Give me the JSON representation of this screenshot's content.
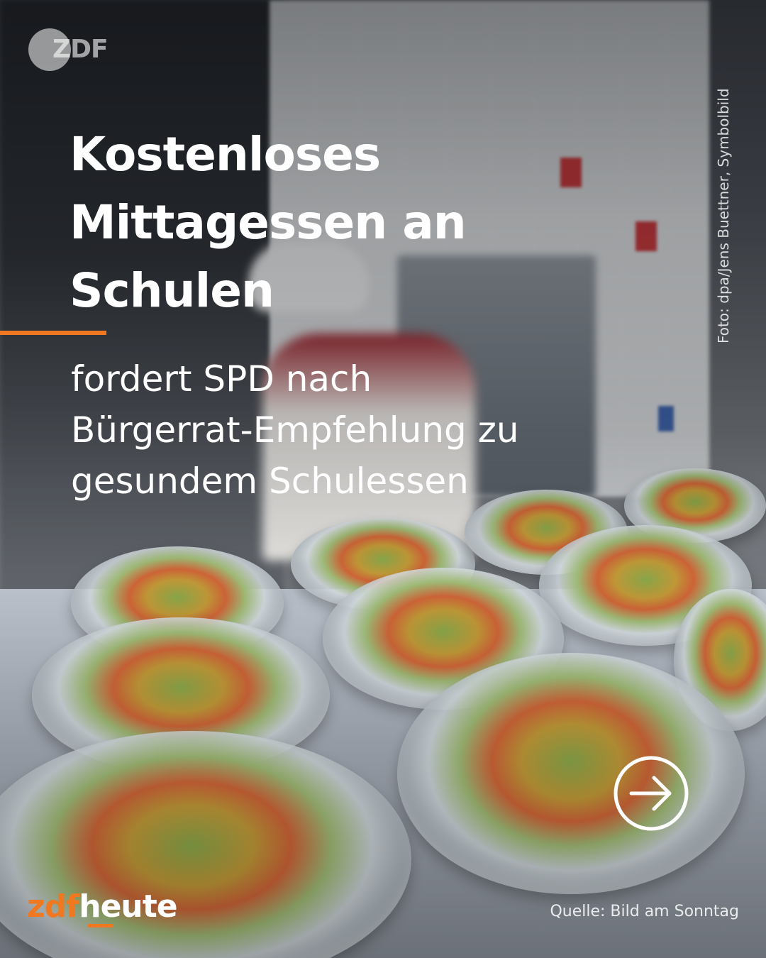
{
  "logo": {
    "text": "ZDF"
  },
  "headline": {
    "line1": "Kostenloses",
    "line2": "Mittagessen an",
    "line3": "Schulen"
  },
  "subline": {
    "line1": "fordert SPD nach",
    "line2": "Bürgerrat-Empfehlung zu",
    "line3": "gesundem Schulessen"
  },
  "photo_credit": "Foto: dpa/Jens Buettner, Symbolbild",
  "brand": {
    "part1": "zdf",
    "part2": "heute"
  },
  "source": "Quelle: Bild am Sonntag",
  "icons": {
    "next": "arrow-right-circle-icon"
  },
  "colors": {
    "accent": "#f07820",
    "text": "#ffffff"
  }
}
